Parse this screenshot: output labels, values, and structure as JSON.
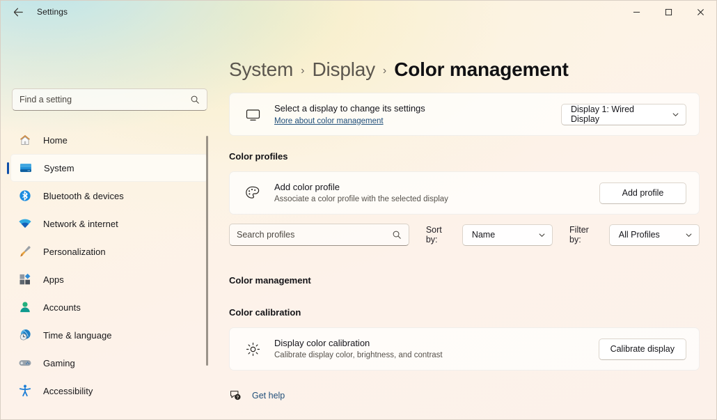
{
  "window": {
    "title": "Settings",
    "back_tooltip": "Back",
    "minimize_label": "—",
    "maximize_label": "□",
    "close_label": "✕"
  },
  "sidebar": {
    "search_placeholder": "Find a setting",
    "search_value": "",
    "items": [
      {
        "label": "Home",
        "icon": "home-icon",
        "selected": false
      },
      {
        "label": "System",
        "icon": "system-icon",
        "selected": true
      },
      {
        "label": "Bluetooth & devices",
        "icon": "bluetooth-icon",
        "selected": false
      },
      {
        "label": "Network & internet",
        "icon": "network-icon",
        "selected": false
      },
      {
        "label": "Personalization",
        "icon": "brush-icon",
        "selected": false
      },
      {
        "label": "Apps",
        "icon": "apps-icon",
        "selected": false
      },
      {
        "label": "Accounts",
        "icon": "accounts-icon",
        "selected": false
      },
      {
        "label": "Time & language",
        "icon": "clock-globe-icon",
        "selected": false
      },
      {
        "label": "Gaming",
        "icon": "gamepad-icon",
        "selected": false
      },
      {
        "label": "Accessibility",
        "icon": "accessibility-icon",
        "selected": false
      }
    ]
  },
  "breadcrumb": {
    "segments": [
      "System",
      "Display",
      "Color management"
    ],
    "separator": "›"
  },
  "display_card": {
    "icon": "monitor-icon",
    "title": "Select a display to change its settings",
    "link": "More about color management",
    "selector_value": "Display 1: Wired Display",
    "chevron": "⌄"
  },
  "color_profiles": {
    "heading": "Color profiles",
    "add_card": {
      "icon": "palette-icon",
      "title": "Add color profile",
      "subtitle": "Associate a color profile with the selected display",
      "button": "Add profile"
    },
    "search_placeholder": "Search profiles",
    "search_value": "",
    "sort_label": "Sort by:",
    "sort_value": "Name",
    "filter_label": "Filter by:",
    "filter_value": "All Profiles"
  },
  "color_management": {
    "heading": "Color management"
  },
  "color_calibration": {
    "heading": "Color calibration",
    "card": {
      "icon": "brightness-icon",
      "title": "Display color calibration",
      "subtitle": "Calibrate display color, brightness, and contrast",
      "button": "Calibrate display"
    }
  },
  "footer": {
    "help_icon": "help-bubble-icon",
    "help_label": "Get help"
  },
  "colors": {
    "accent": "#0f4fa8",
    "link": "#1f4e79",
    "text_primary": "#13131a",
    "text_secondary": "#56524c",
    "window_bg": "#fdf3e6"
  }
}
